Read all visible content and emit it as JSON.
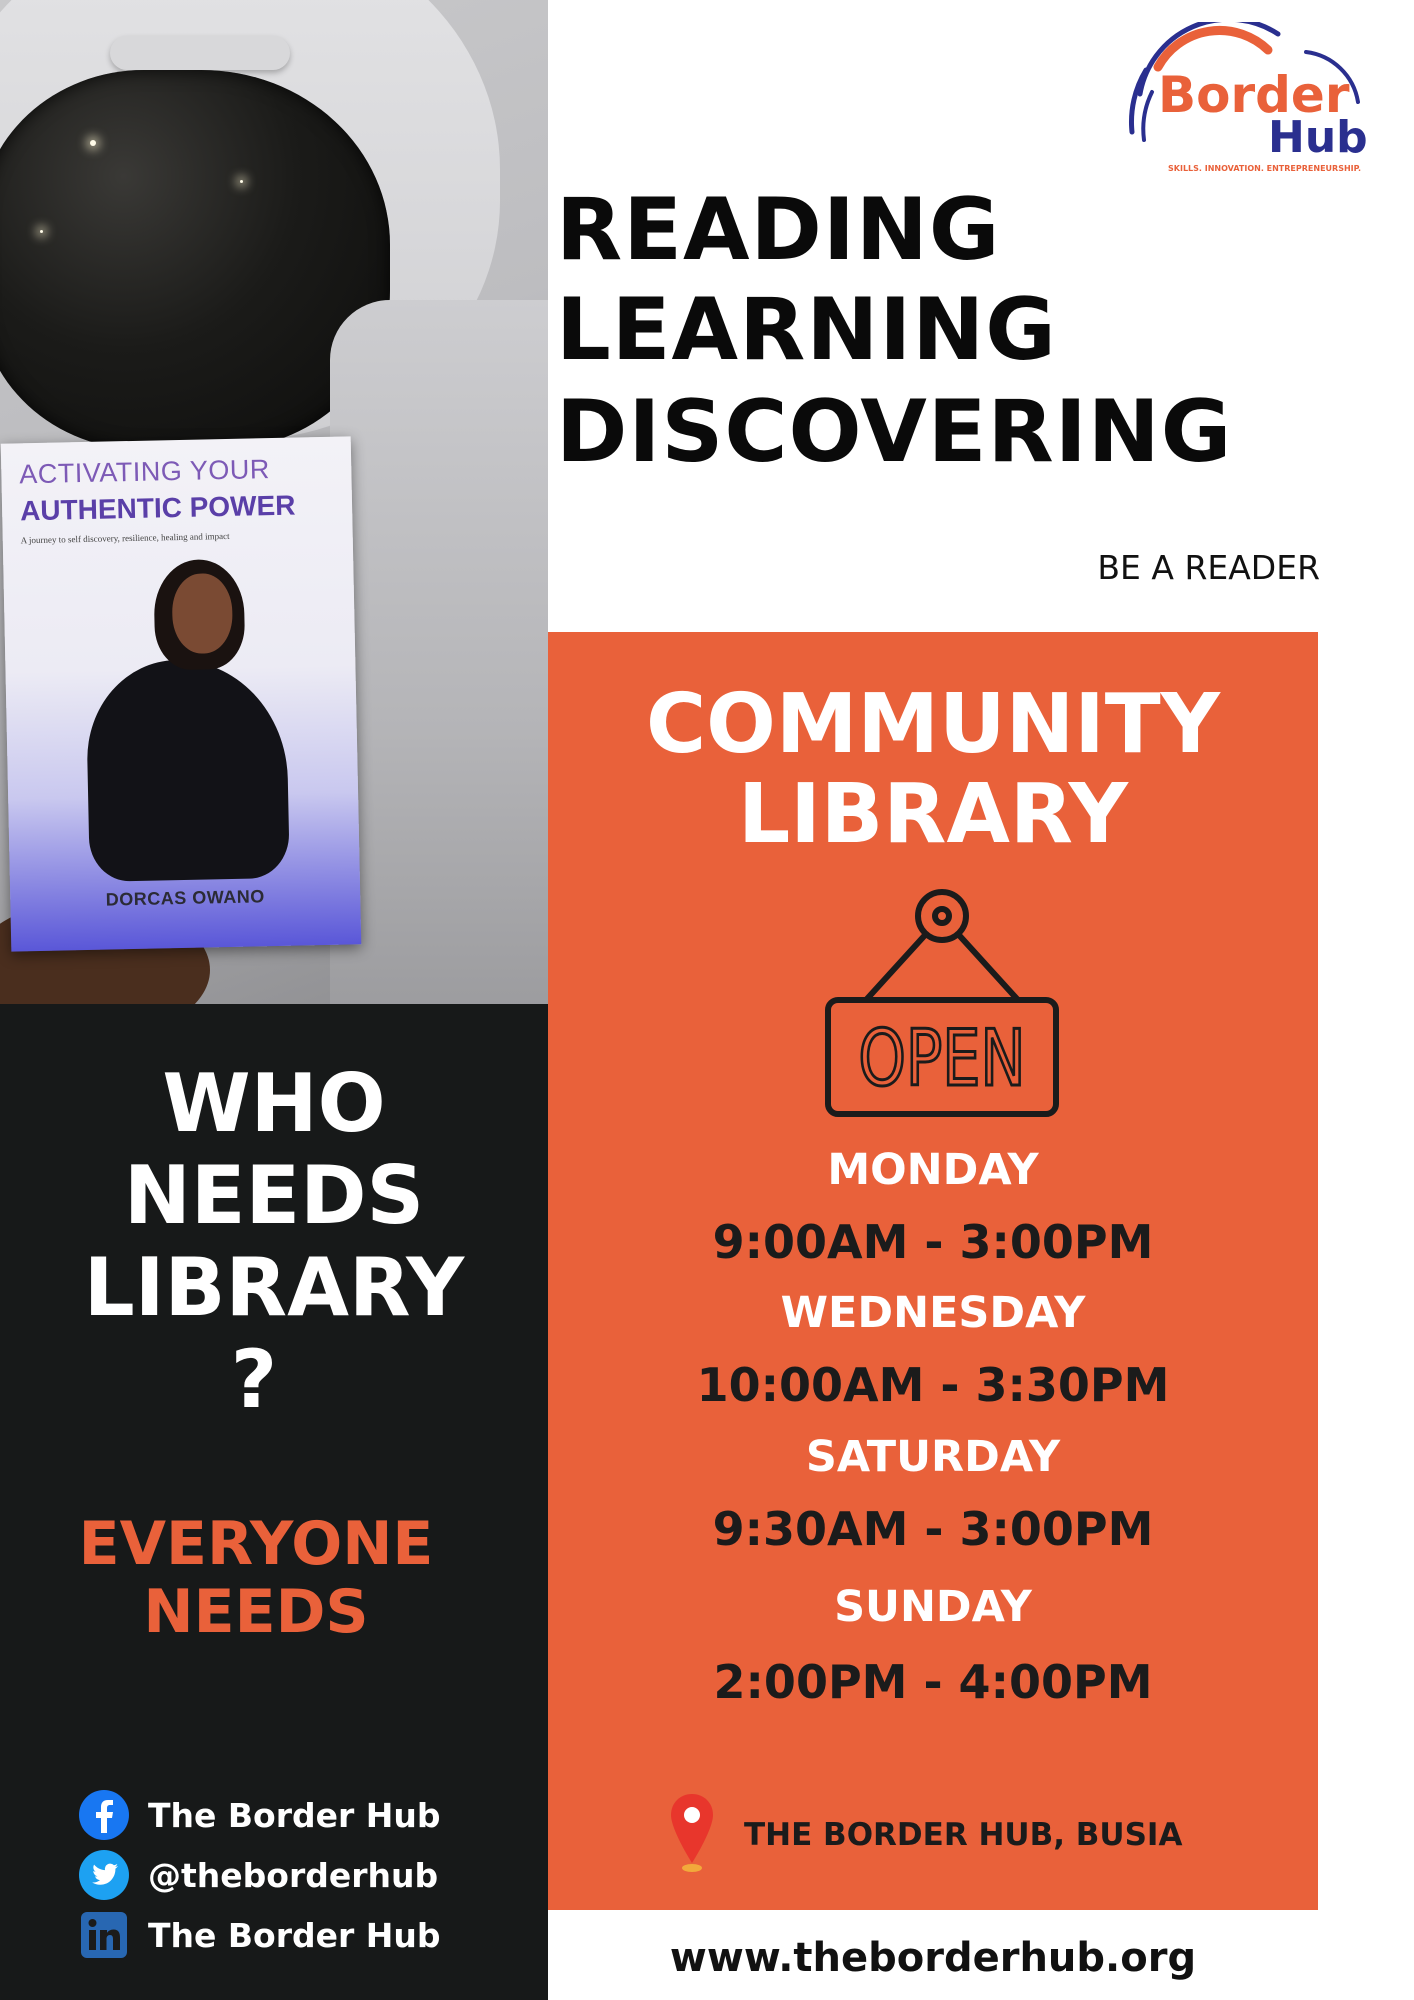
{
  "book": {
    "title_line1": "ACTIVATING YOUR",
    "title_line2": "AUTHENTIC POWER",
    "subtitle": "A journey to self discovery, resilience, healing and impact",
    "author": "DORCAS OWANO"
  },
  "logo": {
    "word1": "Border",
    "word2": "Hub",
    "tagline": "SKILLS. INNOVATION. ENTREPRENEURSHIP.",
    "colors": {
      "orange": "#e9613a",
      "navy": "#2a2f8f"
    }
  },
  "headline": [
    "READING",
    "LEARNING",
    "DISCOVERING"
  ],
  "be_a_reader": "BE A READER",
  "community": {
    "title_line1": "COMMUNITY",
    "title_line2": "LIBRARY",
    "sign_text": "OPEN",
    "schedule": [
      {
        "day": "MONDAY",
        "hours": "9:00AM - 3:00PM"
      },
      {
        "day": "WEDNESDAY",
        "hours": "10:00AM - 3:30PM"
      },
      {
        "day": "SATURDAY",
        "hours": "9:30AM - 3:00PM"
      },
      {
        "day": "SUNDAY",
        "hours": "2:00PM - 4:00PM"
      }
    ],
    "location": "THE BORDER HUB, BUSIA",
    "location_icon": "map-pin-icon"
  },
  "left_panel": {
    "question_lines": [
      "WHO",
      "NEEDS",
      "LIBRARY",
      "?"
    ],
    "answer_lines": [
      "EVERYONE",
      "NEEDS"
    ],
    "social": [
      {
        "icon": "facebook-icon",
        "label": "The Border Hub"
      },
      {
        "icon": "twitter-icon",
        "label": "@theborderhub"
      },
      {
        "icon": "linkedin-icon",
        "label": "The Border Hub"
      }
    ]
  },
  "website": "www.theborderhub.org",
  "colors": {
    "accent_orange": "#e9613a",
    "dark_panel": "#171919",
    "text_dark": "#1b1b1b"
  }
}
